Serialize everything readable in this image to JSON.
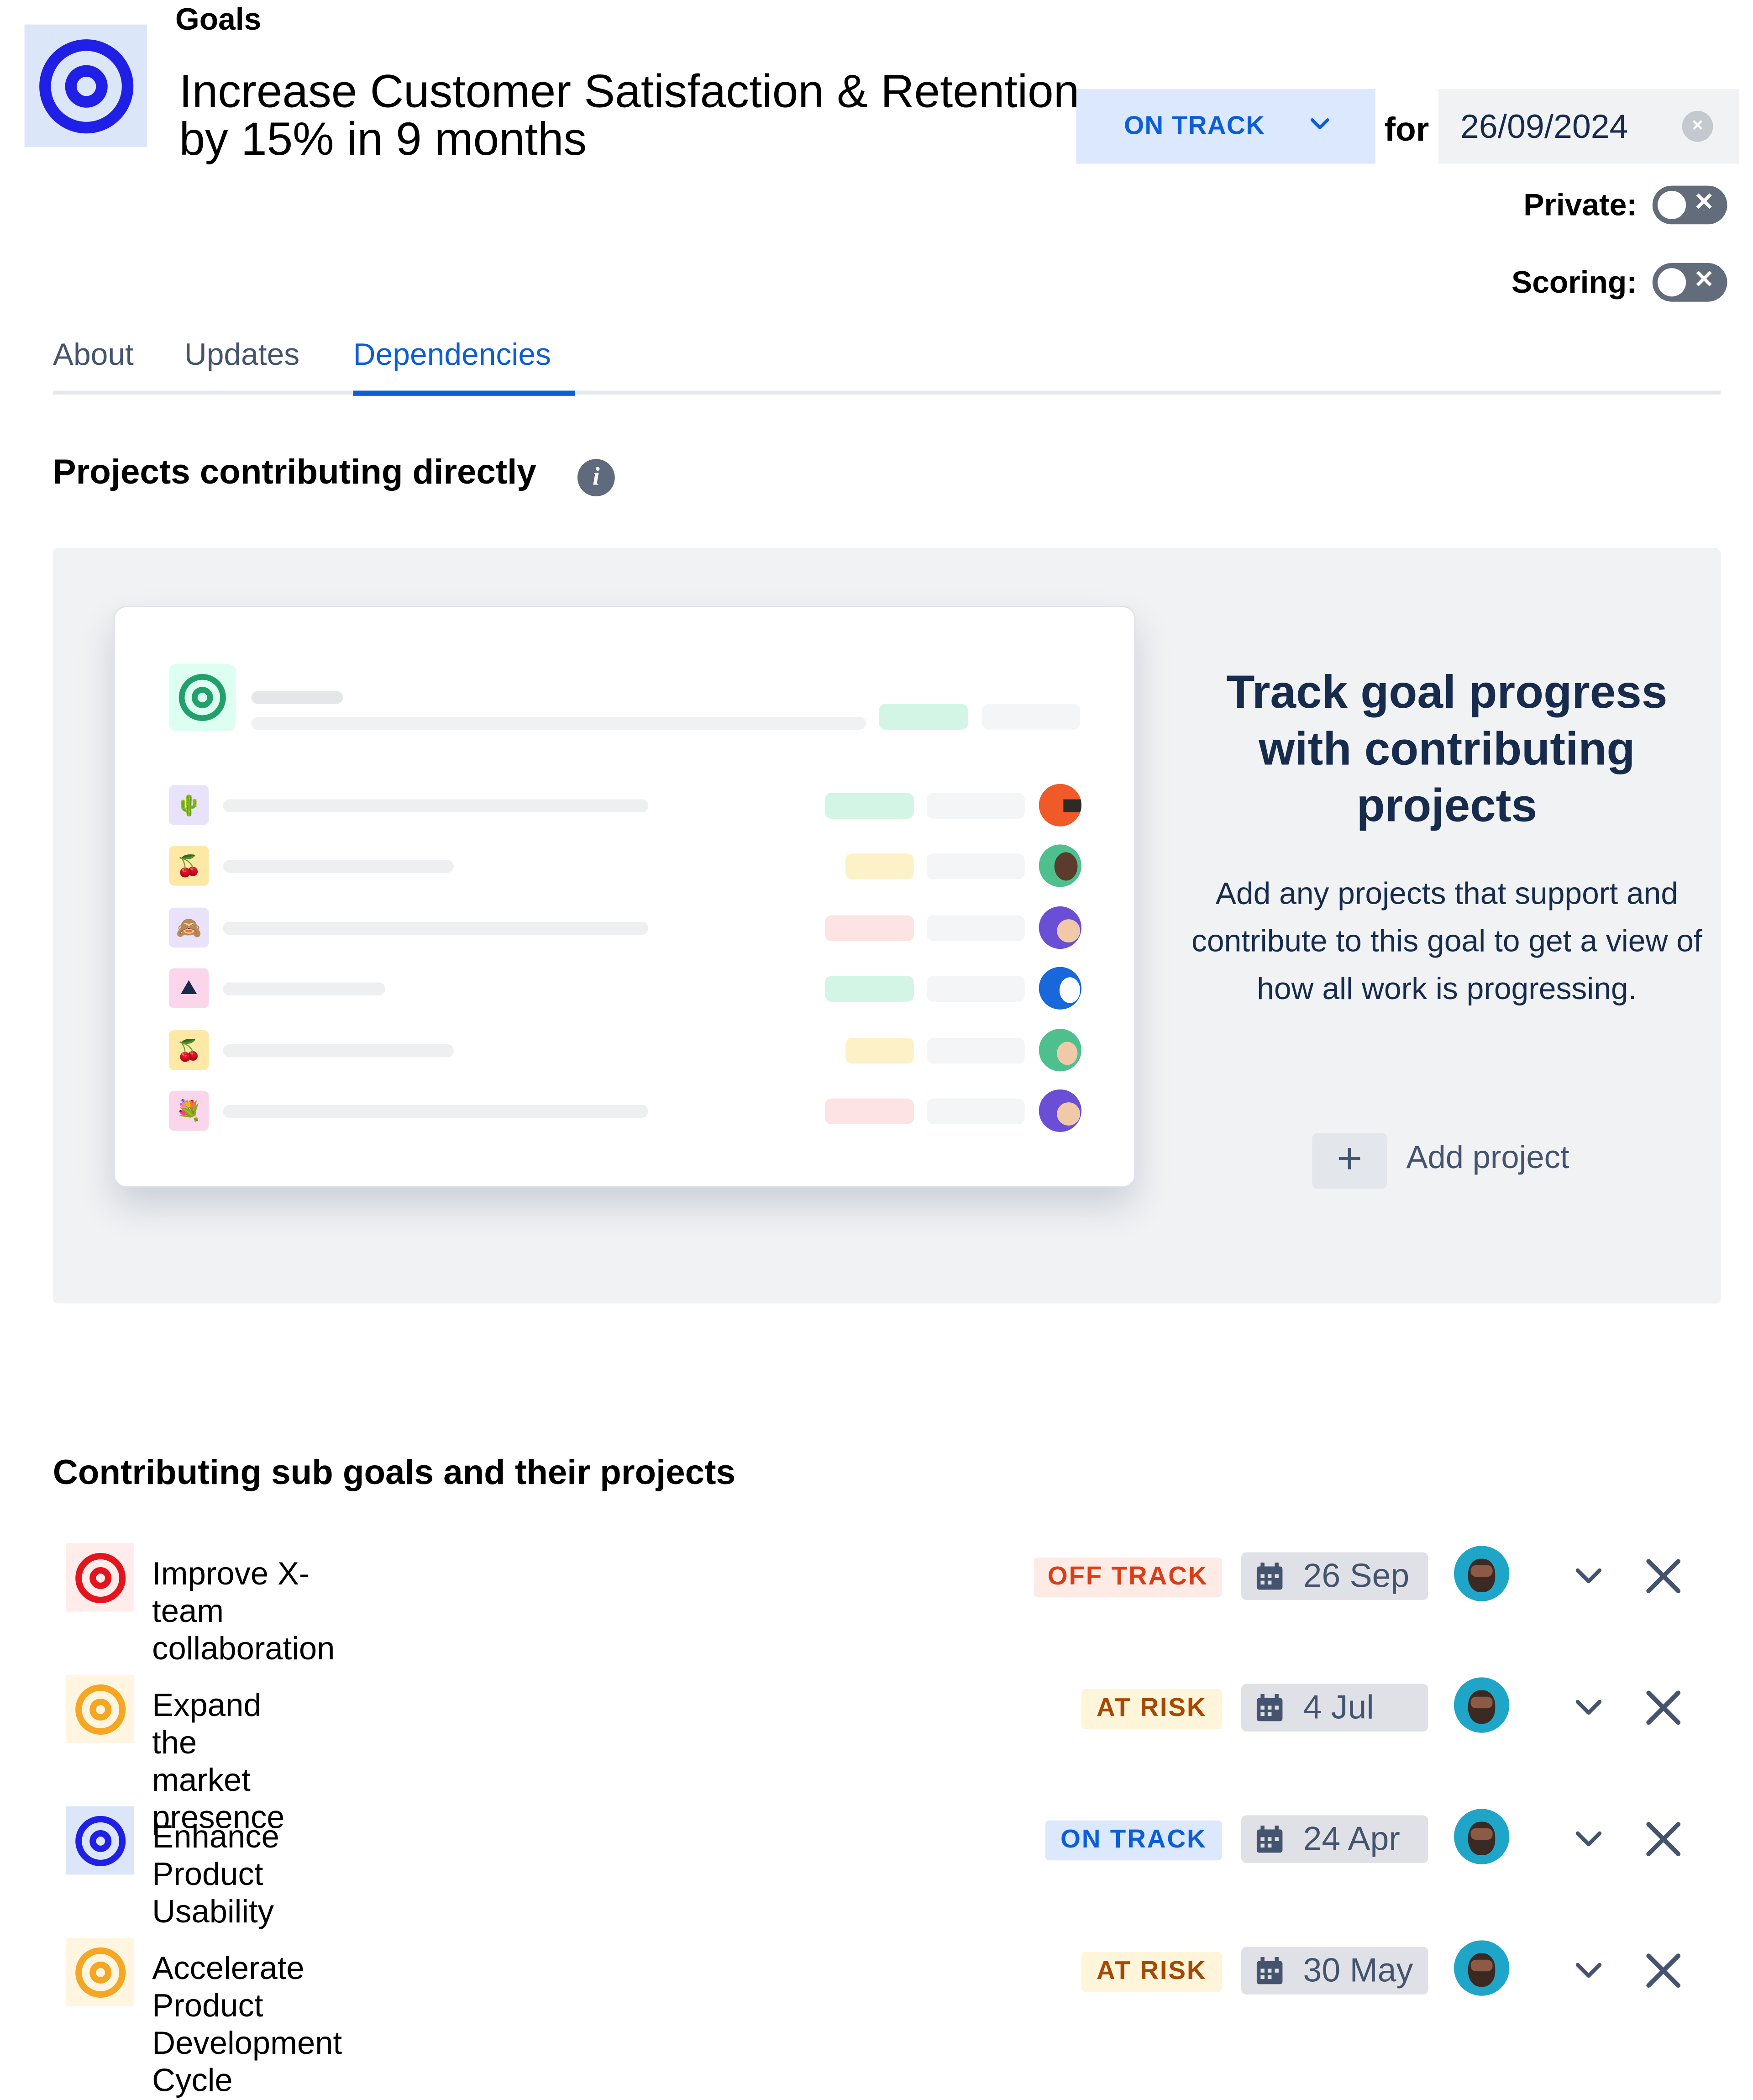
{
  "header": {
    "breadcrumb": "Goals",
    "title": "Increase Customer Satisfaction & Retention by 15% in 9 months",
    "status": "ON TRACK",
    "for_label": "for",
    "target_date": "26/09/2024",
    "private_label": "Private:",
    "scoring_label": "Scoring:"
  },
  "tabs": [
    {
      "label": "About"
    },
    {
      "label": "Updates"
    },
    {
      "label": "Dependencies",
      "active": true
    }
  ],
  "projects_section": {
    "title": "Projects contributing directly",
    "info_icon": "info-icon",
    "empty_title": "Track goal progress with contributing projects",
    "empty_body": "Add any projects that support and contribute to this goal to get a view of how all work is progressing.",
    "add_button_label": "Add project"
  },
  "subgoals_section": {
    "title": "Contributing sub goals and their projects",
    "items": [
      {
        "title": "Improve X-team collaboration",
        "status": "OFF TRACK",
        "date": "26 Sep",
        "color": "#e2141d"
      },
      {
        "title": "Expand the market presence",
        "status": "AT RISK",
        "date": "4 Jul",
        "color": "#f5a623"
      },
      {
        "title": "Enhance Product Usability",
        "status": "ON TRACK",
        "date": "24 Apr",
        "color": "#1f1fe6"
      },
      {
        "title": "Accelerate Product Development Cycle",
        "status": "AT RISK",
        "date": "30 May",
        "color": "#f5a623"
      }
    ]
  },
  "colors": {
    "goal_icon": "#1f1fe6",
    "on_track_bg": "#dbe8fd",
    "on_track_text": "#0c5ed6",
    "off_track_bg": "#ffebe6",
    "off_track_text": "#d93e16",
    "at_risk_bg": "#fff5db",
    "at_risk_text": "#a54900"
  }
}
